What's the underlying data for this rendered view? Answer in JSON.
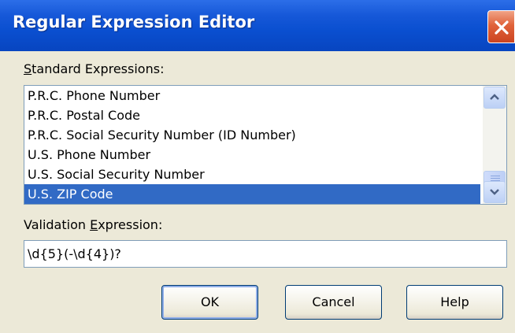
{
  "window": {
    "title": "Regular Expression Editor"
  },
  "standard": {
    "label_underlined": "S",
    "label_rest": "tandard Expressions:",
    "items": [
      {
        "label": "P.R.C. Phone Number",
        "selected": false
      },
      {
        "label": "P.R.C. Postal Code",
        "selected": false
      },
      {
        "label": "P.R.C. Social Security Number (ID Number)",
        "selected": false
      },
      {
        "label": "U.S. Phone Number",
        "selected": false
      },
      {
        "label": "U.S. Social Security Number",
        "selected": false
      },
      {
        "label": "U.S. ZIP Code",
        "selected": true
      }
    ]
  },
  "validation": {
    "label_before": "Validation ",
    "label_underlined": "E",
    "label_after": "xpression:",
    "value": "\\d{5}(-\\d{4})?"
  },
  "buttons": {
    "ok": "OK",
    "cancel": "Cancel",
    "help": "Help"
  },
  "colors": {
    "titlebar": "#0a4fd0",
    "selection": "#316ac5",
    "dialog_bg": "#ece9d8",
    "close": "#e0623a"
  },
  "icons": {
    "close": "close-icon",
    "scroll_up": "chevron-up-icon",
    "scroll_down": "chevron-down-icon",
    "thumb_grip": "grip-icon"
  }
}
